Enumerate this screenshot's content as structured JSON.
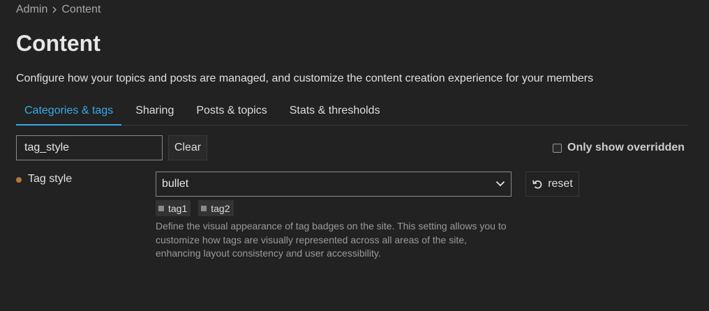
{
  "breadcrumb": {
    "items": [
      "Admin",
      "Content"
    ]
  },
  "page": {
    "title": "Content",
    "description": "Configure how your topics and posts are managed, and customize the content creation experience for your members"
  },
  "tabs": [
    {
      "label": "Categories & tags",
      "active": true
    },
    {
      "label": "Sharing",
      "active": false
    },
    {
      "label": "Posts & topics",
      "active": false
    },
    {
      "label": "Stats & thresholds",
      "active": false
    }
  ],
  "filter": {
    "value": "tag_style",
    "clear_label": "Clear",
    "only_overridden_label": "Only show overridden",
    "only_overridden_checked": false
  },
  "setting": {
    "label": "Tag style",
    "value": "bullet",
    "reset_label": "reset",
    "sample_tags": [
      "tag1",
      "tag2"
    ],
    "description": "Define the visual appearance of tag badges on the site. This setting allows you to customize how tags are visually represented across all areas of the site, enhancing layout consistency and user accessibility."
  },
  "colors": {
    "background": "#222222",
    "accent": "#3aa9e8",
    "override_dot": "#b07a3a"
  }
}
